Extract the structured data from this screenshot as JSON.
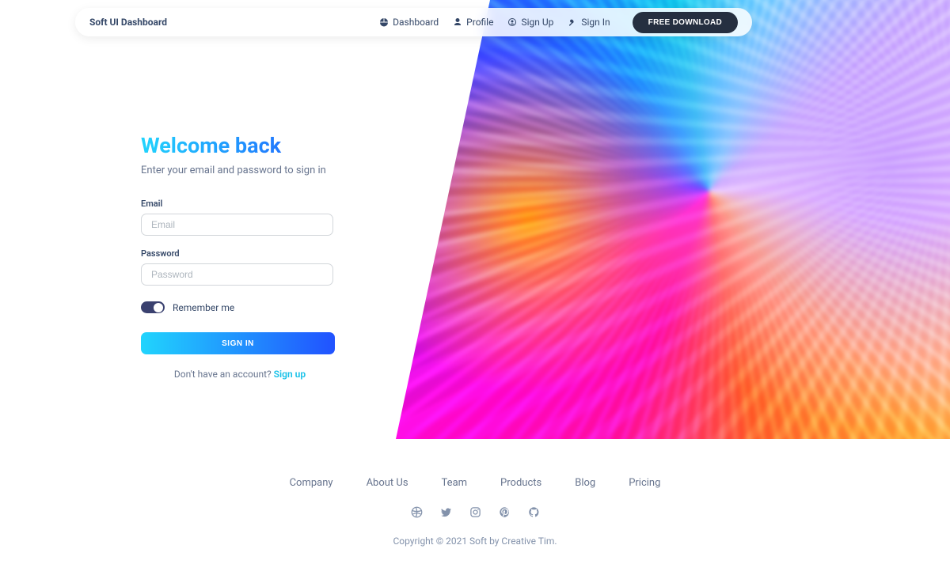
{
  "navbar": {
    "brand": "Soft UI Dashboard",
    "links": {
      "dashboard": "Dashboard",
      "profile": "Profile",
      "signup": "Sign Up",
      "signin": "Sign In"
    },
    "download": "FREE DOWNLOAD"
  },
  "form": {
    "title": "Welcome back",
    "subtitle": "Enter your email and password to sign in",
    "email_label": "Email",
    "email_placeholder": "Email",
    "password_label": "Password",
    "password_placeholder": "Password",
    "remember_label": "Remember me",
    "submit": "SIGN IN",
    "signup_prompt": "Don't have an account? ",
    "signup_link": "Sign up"
  },
  "footer": {
    "links": {
      "company": "Company",
      "about": "About Us",
      "team": "Team",
      "products": "Products",
      "blog": "Blog",
      "pricing": "Pricing"
    },
    "copyright": "Copyright © 2021 Soft by Creative Tim."
  }
}
